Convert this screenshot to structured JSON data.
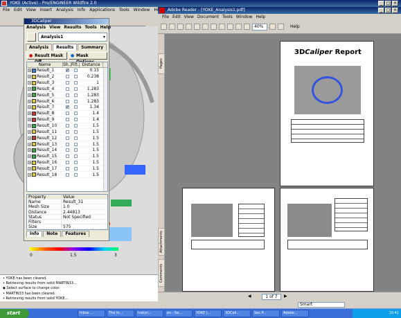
{
  "pe": {
    "title": "YOKE (Active) - Pro/ENGINEER Wildfire 2.0",
    "menu": [
      "File",
      "Edit",
      "View",
      "Insert",
      "Analysis",
      "Info",
      "Applications",
      "Tools",
      "Window",
      "Help"
    ]
  },
  "caliper": {
    "title": "3DCaliper",
    "menu": [
      "Analysis",
      "View",
      "Results",
      "Tools",
      "Help"
    ],
    "selected_analysis": "Analysis1",
    "tabs": [
      "Analysis",
      "Results",
      "Summary"
    ],
    "active_tab": "Results",
    "result_mask_label": "Result Mask Off",
    "mask_options_label": "Mask Options",
    "columns": [
      "Name",
      "Sh..",
      "Filt..",
      "Distance"
    ],
    "rows": [
      {
        "name": "Result_1",
        "sh": "✔",
        "dist": "0.15",
        "color": "#3a7ed8"
      },
      {
        "name": "Result_2",
        "sh": "",
        "dist": "0.238",
        "color": "#ddcc33"
      },
      {
        "name": "Result_3",
        "sh": "",
        "dist": "1",
        "color": "#ddcc33"
      },
      {
        "name": "Result_4",
        "sh": "",
        "dist": "1.283",
        "color": "#33aa44"
      },
      {
        "name": "Result_5",
        "sh": "",
        "dist": "1.283",
        "color": "#33aa44"
      },
      {
        "name": "Result_6",
        "sh": "",
        "dist": "1.283",
        "color": "#ddcc33"
      },
      {
        "name": "Result_7",
        "sh": "✔",
        "dist": "1.34",
        "color": "#ddcc33"
      },
      {
        "name": "Result_8",
        "sh": "",
        "dist": "1.4",
        "color": "#cc3333"
      },
      {
        "name": "Result_9",
        "sh": "",
        "dist": "1.4",
        "color": "#cc3333"
      },
      {
        "name": "Result_10",
        "sh": "",
        "dist": "1.5",
        "color": "#33aa44"
      },
      {
        "name": "Result_11",
        "sh": "",
        "dist": "1.5",
        "color": "#ddcc33"
      },
      {
        "name": "Result_12",
        "sh": "",
        "dist": "1.5",
        "color": "#cc3333"
      },
      {
        "name": "Result_13",
        "sh": "",
        "dist": "1.5",
        "color": "#ddcc33"
      },
      {
        "name": "Result_14",
        "sh": "",
        "dist": "1.5",
        "color": "#33aa44"
      },
      {
        "name": "Result_15",
        "sh": "",
        "dist": "1.5",
        "color": "#33aa44"
      },
      {
        "name": "Result_16",
        "sh": "",
        "dist": "1.5",
        "color": "#ddcc33"
      },
      {
        "name": "Result_17",
        "sh": "",
        "dist": "1.5",
        "color": "#ddcc33"
      },
      {
        "name": "Result_18",
        "sh": "",
        "dist": "1.5",
        "color": "#ddcc33"
      }
    ],
    "property_header": [
      "Property",
      "Value"
    ],
    "properties": [
      [
        "Name",
        "Result_31"
      ],
      [
        "Mesh Size",
        "1.0"
      ],
      [
        "Distance",
        "2.44813"
      ],
      [
        "Status",
        "Not Specified"
      ],
      [
        "Filters",
        ""
      ],
      [
        "Size",
        "575"
      ]
    ],
    "prop_tabs": [
      "Info",
      "Note",
      "Features"
    ],
    "legend": [
      "0",
      "1.5",
      "3"
    ]
  },
  "messages": [
    "• YOKE has been cleared.",
    "• Retrieving results from solid MARTIN33...",
    "◆ Select surface to change color.",
    "• MARTIN33 has been cleared.",
    "• Retrieving results from solid YOKE..."
  ],
  "acrobat": {
    "title": "Adobe Reader - [YOKE_Analysis1.pdf]",
    "menu": [
      "File",
      "Edit",
      "View",
      "Document",
      "Tools",
      "Window",
      "Help"
    ],
    "zoom": "40%",
    "help_label": "Help",
    "side_tabs": [
      "Pages",
      "Attachments",
      "Comments"
    ],
    "report_title_pre": "3D",
    "report_title_em": "Caliper",
    "report_title_post": " Report",
    "page_nav": "1 of 7",
    "search_value": "Smart"
  },
  "taskbar": {
    "start_label": "start",
    "items": [
      "Inbox ...",
      "The In...",
      "Instyn...",
      "ev - Se...",
      "YOKE (...",
      "3DCali...",
      "Sec P...",
      "Adobe..."
    ],
    "clock": "10:41"
  }
}
